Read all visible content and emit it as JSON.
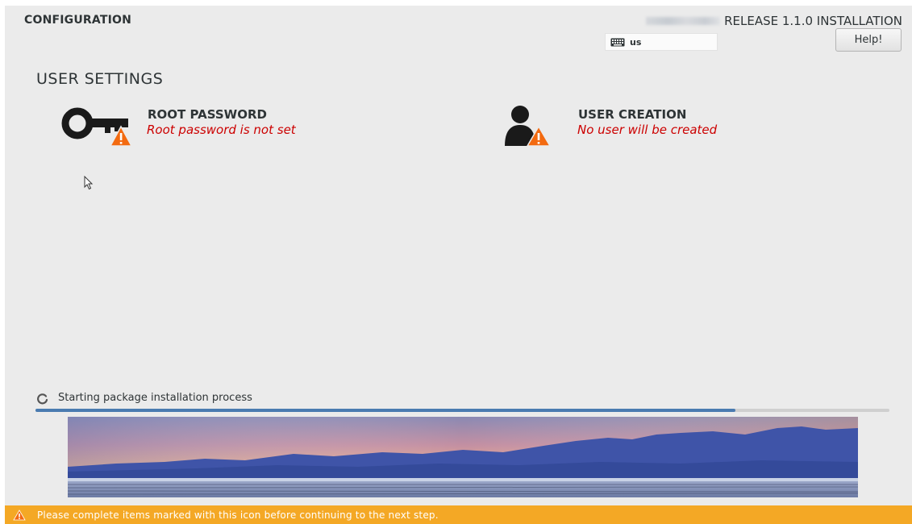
{
  "header": {
    "section_title": "CONFIGURATION",
    "product_title": "RELEASE 1.1.0 INSTALLATION",
    "keyboard_layout": "us",
    "help_label": "Help!"
  },
  "user_settings": {
    "heading": "USER SETTINGS",
    "spokes": [
      {
        "title": "ROOT PASSWORD",
        "status": "Root password is not set",
        "icon": "key-icon"
      },
      {
        "title": "USER CREATION",
        "status": "No user will be created",
        "icon": "user-icon"
      }
    ]
  },
  "progress": {
    "message": "Starting package installation process",
    "fraction": 0.82
  },
  "warning_bar": {
    "message": "Please complete items marked with this icon before continuing to the next step."
  },
  "colors": {
    "background": "#ebebeb",
    "status_red": "#cc0000",
    "warning_orange": "#f4a825",
    "progress_blue": "#4a7bb0"
  }
}
